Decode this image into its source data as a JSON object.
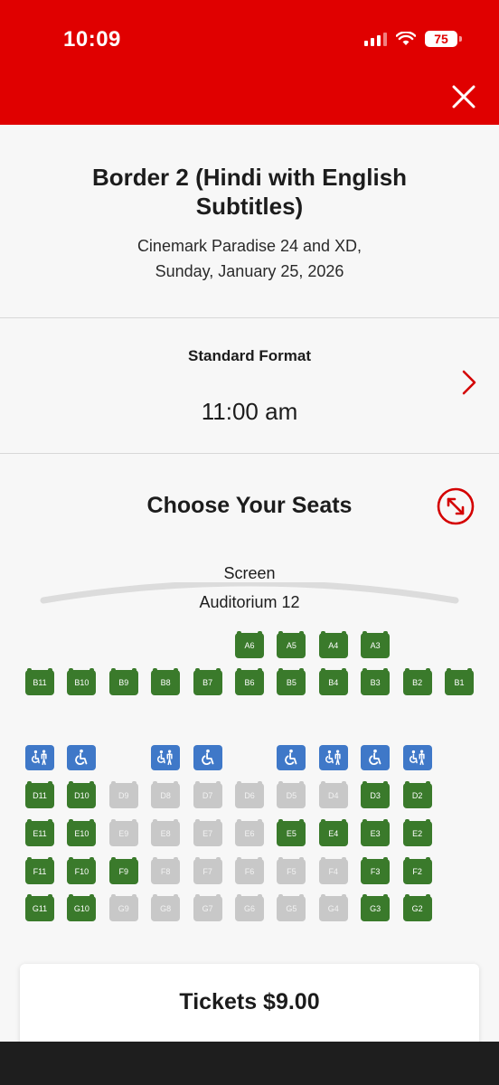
{
  "status_bar": {
    "time": "10:09",
    "battery": "75"
  },
  "header": {
    "close_icon": "close-icon",
    "color": "#e00000"
  },
  "movie": {
    "title": "Border 2 (Hindi with English Subtitles)",
    "theater": "Cinemark Paradise 24 and XD,",
    "date": "Sunday, January 25, 2026"
  },
  "showtime": {
    "format": "Standard Format",
    "time": "11:00 am"
  },
  "seating": {
    "title": "Choose Your Seats",
    "screen_label": "Screen",
    "auditorium": "Auditorium 12",
    "colors": {
      "available": "#3a7a2b",
      "taken": "#c8c8c8",
      "accessible": "#3f78c8"
    },
    "rows": [
      {
        "row": "A",
        "seats": [
          {
            "id": "A6",
            "col": 6,
            "status": "available"
          },
          {
            "id": "A5",
            "col": 7,
            "status": "available"
          },
          {
            "id": "A4",
            "col": 8,
            "status": "available"
          },
          {
            "id": "A3",
            "col": 9,
            "status": "available"
          }
        ]
      },
      {
        "row": "B",
        "seats": [
          {
            "id": "B11",
            "col": 1,
            "status": "available"
          },
          {
            "id": "B10",
            "col": 2,
            "status": "available"
          },
          {
            "id": "B9",
            "col": 3,
            "status": "available"
          },
          {
            "id": "B8",
            "col": 4,
            "status": "available"
          },
          {
            "id": "B7",
            "col": 5,
            "status": "available"
          },
          {
            "id": "B6",
            "col": 6,
            "status": "available"
          },
          {
            "id": "B5",
            "col": 7,
            "status": "available"
          },
          {
            "id": "B4",
            "col": 8,
            "status": "available"
          },
          {
            "id": "B3",
            "col": 9,
            "status": "available"
          },
          {
            "id": "B2",
            "col": 10,
            "status": "available"
          },
          {
            "id": "B1",
            "col": 11,
            "status": "available"
          }
        ]
      },
      {
        "row": "C",
        "seats": [
          {
            "id": "",
            "col": 1,
            "status": "companion"
          },
          {
            "id": "",
            "col": 2,
            "status": "wheelchair"
          },
          {
            "id": "",
            "col": 4,
            "status": "companion"
          },
          {
            "id": "",
            "col": 5,
            "status": "wheelchair"
          },
          {
            "id": "",
            "col": 7,
            "status": "wheelchair"
          },
          {
            "id": "",
            "col": 8,
            "status": "companion"
          },
          {
            "id": "",
            "col": 9,
            "status": "wheelchair"
          },
          {
            "id": "",
            "col": 10,
            "status": "companion"
          }
        ]
      },
      {
        "row": "D",
        "seats": [
          {
            "id": "D11",
            "col": 1,
            "status": "available"
          },
          {
            "id": "D10",
            "col": 2,
            "status": "available"
          },
          {
            "id": "D9",
            "col": 3,
            "status": "taken"
          },
          {
            "id": "D8",
            "col": 4,
            "status": "taken"
          },
          {
            "id": "D7",
            "col": 5,
            "status": "taken"
          },
          {
            "id": "D6",
            "col": 6,
            "status": "taken"
          },
          {
            "id": "D5",
            "col": 7,
            "status": "taken"
          },
          {
            "id": "D4",
            "col": 8,
            "status": "taken"
          },
          {
            "id": "D3",
            "col": 9,
            "status": "available"
          },
          {
            "id": "D2",
            "col": 10,
            "status": "available"
          }
        ]
      },
      {
        "row": "E",
        "seats": [
          {
            "id": "E11",
            "col": 1,
            "status": "available"
          },
          {
            "id": "E10",
            "col": 2,
            "status": "available"
          },
          {
            "id": "E9",
            "col": 3,
            "status": "taken"
          },
          {
            "id": "E8",
            "col": 4,
            "status": "taken"
          },
          {
            "id": "E7",
            "col": 5,
            "status": "taken"
          },
          {
            "id": "E6",
            "col": 6,
            "status": "taken"
          },
          {
            "id": "E5",
            "col": 7,
            "status": "available"
          },
          {
            "id": "E4",
            "col": 8,
            "status": "available"
          },
          {
            "id": "E3",
            "col": 9,
            "status": "available"
          },
          {
            "id": "E2",
            "col": 10,
            "status": "available"
          }
        ]
      },
      {
        "row": "F",
        "seats": [
          {
            "id": "F11",
            "col": 1,
            "status": "available"
          },
          {
            "id": "F10",
            "col": 2,
            "status": "available"
          },
          {
            "id": "F9",
            "col": 3,
            "status": "available"
          },
          {
            "id": "F8",
            "col": 4,
            "status": "taken"
          },
          {
            "id": "F7",
            "col": 5,
            "status": "taken"
          },
          {
            "id": "F6",
            "col": 6,
            "status": "taken"
          },
          {
            "id": "F5",
            "col": 7,
            "status": "taken"
          },
          {
            "id": "F4",
            "col": 8,
            "status": "taken"
          },
          {
            "id": "F3",
            "col": 9,
            "status": "available"
          },
          {
            "id": "F2",
            "col": 10,
            "status": "available"
          }
        ]
      },
      {
        "row": "G",
        "seats": [
          {
            "id": "G11",
            "col": 1,
            "status": "available"
          },
          {
            "id": "G10",
            "col": 2,
            "status": "available"
          },
          {
            "id": "G9",
            "col": 3,
            "status": "taken"
          },
          {
            "id": "G8",
            "col": 4,
            "status": "taken"
          },
          {
            "id": "G7",
            "col": 5,
            "status": "taken"
          },
          {
            "id": "G6",
            "col": 6,
            "status": "taken"
          },
          {
            "id": "G5",
            "col": 7,
            "status": "taken"
          },
          {
            "id": "G4",
            "col": 8,
            "status": "taken"
          },
          {
            "id": "G3",
            "col": 9,
            "status": "available"
          },
          {
            "id": "G2",
            "col": 10,
            "status": "available"
          }
        ]
      }
    ]
  },
  "tickets": {
    "label": "Tickets $9.00"
  }
}
